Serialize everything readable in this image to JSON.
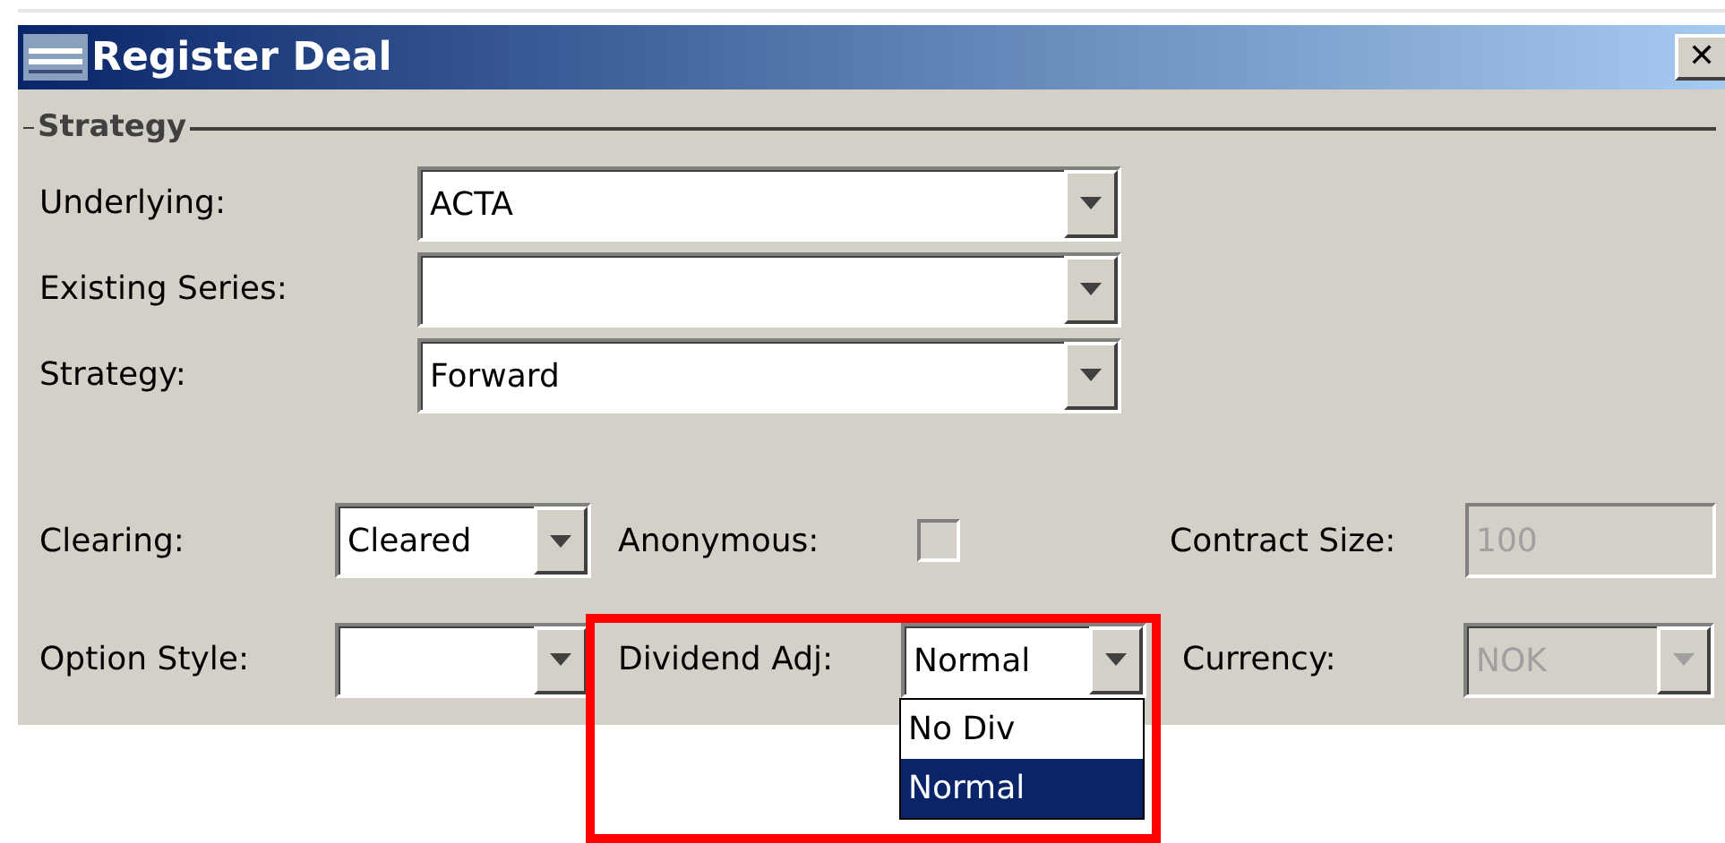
{
  "window": {
    "title": "Register Deal",
    "close": "✕"
  },
  "group": {
    "label": "Strategy"
  },
  "fields": [
    {
      "label": "Underlying:",
      "value": "ACTA"
    },
    {
      "label": "Existing Series:"
    },
    {
      "label": "Strategy:",
      "value": "Forward"
    }
  ],
  "row_1": [
    {
      "kind": "combo",
      "label": "Clearing:",
      "value": "Cleared",
      "disabled": false
    },
    {
      "kind": "checkbox",
      "label": "Anonymous:",
      "checked": false
    },
    {
      "kind": "text",
      "label": "Contract Size:",
      "value": "100",
      "disabled": true
    }
  ],
  "row_2": [
    {
      "kind": "combo",
      "label": "Option Style:",
      "disabled": false
    },
    {
      "kind": "combo",
      "label": "Dividend Adj:",
      "value": "Normal",
      "disabled": false,
      "options": [
        {
          "label": "No Div",
          "selected": false
        },
        {
          "label": "Normal",
          "selected": true
        }
      ]
    },
    {
      "kind": "combo",
      "label": "Currency:",
      "value": "NOK",
      "disabled": true
    }
  ]
}
